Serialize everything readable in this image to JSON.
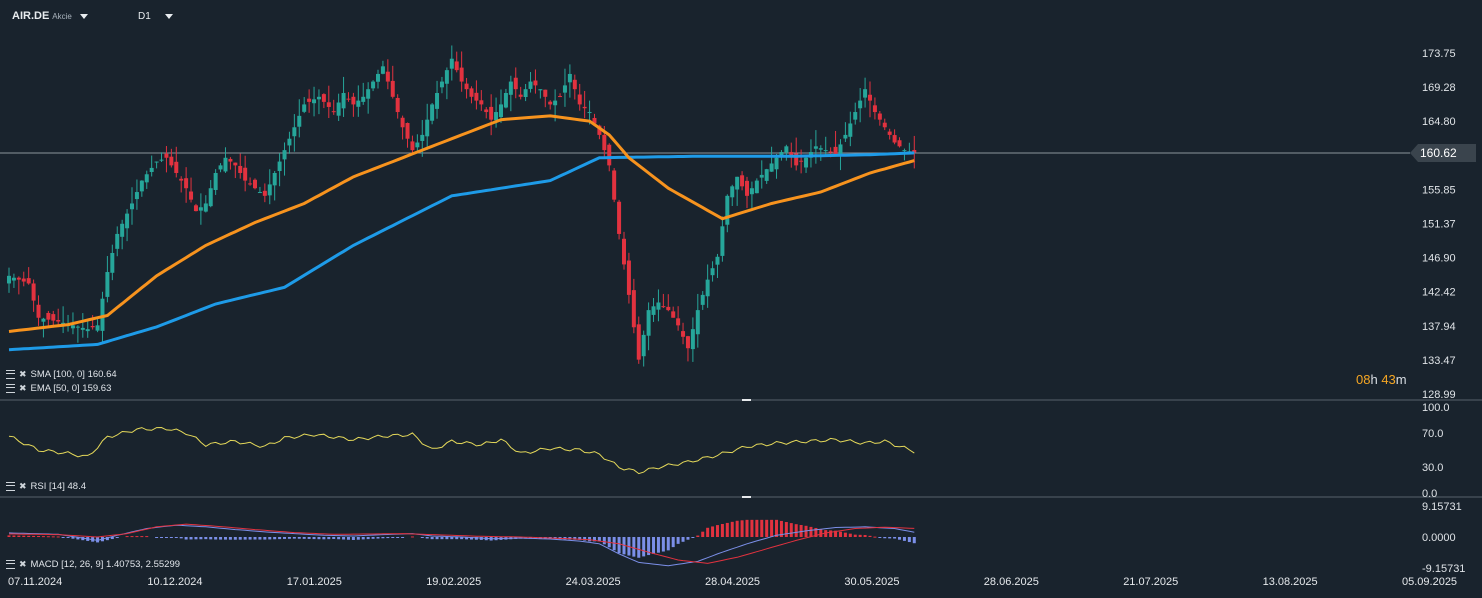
{
  "header": {
    "symbol": "AIR.DE",
    "type": "Akcie",
    "timeframe": "D1"
  },
  "timer": {
    "h": "08",
    "h_unit": "h",
    "m": "43",
    "m_unit": "m"
  },
  "indicators": {
    "sma": "SMA [100, 0] 160.64",
    "ema": "EMA [50, 0] 159.63",
    "rsi": "RSI [14] 48.4",
    "macd": "MACD [12, 26, 9] 1.40753, 2.55299"
  },
  "colors": {
    "bg": "#19232d",
    "up": "#26a69a",
    "down": "#e2323f",
    "sma": "#1e9be8",
    "ema": "#f7931e",
    "rsi": "#e5d95a",
    "macd_signal": "#e2323f",
    "macd_line": "#7b8fe8"
  },
  "chart_data": {
    "type": "candlestick",
    "price_axis": {
      "ticks": [
        "173.75",
        "169.28",
        "164.80",
        "160.62",
        "155.85",
        "151.37",
        "146.90",
        "142.42",
        "137.94",
        "133.47",
        "128.99"
      ],
      "min": 128.99,
      "max": 173.75,
      "current": "160.62"
    },
    "rsi_axis": {
      "ticks": [
        "100.0",
        "70.0",
        "30.0",
        "0.0"
      ]
    },
    "macd_axis": {
      "ticks": [
        "9.15731",
        "0.0000",
        "-9.15731"
      ]
    },
    "x_labels": [
      "07.11.2024",
      "10.12.2024",
      "17.01.2025",
      "19.02.2025",
      "24.03.2025",
      "28.04.2025",
      "30.05.2025",
      "28.06.2025",
      "21.07.2025",
      "13.08.2025",
      "05.09.2025"
    ],
    "anchors": [
      [
        0,
        144.5
      ],
      [
        4,
        143.5
      ],
      [
        6,
        139
      ],
      [
        10,
        138.5
      ],
      [
        13,
        138
      ],
      [
        16,
        137.5
      ],
      [
        18,
        138
      ],
      [
        20,
        145
      ],
      [
        22,
        150
      ],
      [
        25,
        154
      ],
      [
        27,
        157
      ],
      [
        30,
        159.5
      ],
      [
        32,
        160
      ],
      [
        34,
        158
      ],
      [
        36,
        156
      ],
      [
        38,
        153
      ],
      [
        40,
        154
      ],
      [
        42,
        158
      ],
      [
        44,
        160
      ],
      [
        46,
        159
      ],
      [
        48,
        157
      ],
      [
        50,
        156
      ],
      [
        52,
        155
      ],
      [
        54,
        158
      ],
      [
        56,
        161
      ],
      [
        58,
        164
      ],
      [
        60,
        167
      ],
      [
        63,
        168
      ],
      [
        66,
        166
      ],
      [
        68,
        168.5
      ],
      [
        70,
        167
      ],
      [
        72,
        168
      ],
      [
        74,
        170
      ],
      [
        76,
        172
      ],
      [
        78,
        168
      ],
      [
        80,
        164
      ],
      [
        82,
        161
      ],
      [
        84,
        163
      ],
      [
        86,
        167
      ],
      [
        88,
        170
      ],
      [
        90,
        173
      ],
      [
        92,
        170
      ],
      [
        94,
        168
      ],
      [
        96,
        167
      ],
      [
        98,
        165
      ],
      [
        100,
        167
      ],
      [
        102,
        170
      ],
      [
        104,
        168
      ],
      [
        106,
        170
      ],
      [
        108,
        169
      ],
      [
        110,
        167
      ],
      [
        112,
        168
      ],
      [
        114,
        171
      ],
      [
        116,
        167
      ],
      [
        118,
        166
      ],
      [
        120,
        163
      ],
      [
        122,
        159
      ],
      [
        124,
        150
      ],
      [
        126,
        142
      ],
      [
        128,
        133.5
      ],
      [
        130,
        140
      ],
      [
        132,
        141
      ],
      [
        134,
        140
      ],
      [
        136,
        138
      ],
      [
        138,
        135
      ],
      [
        140,
        140
      ],
      [
        142,
        144
      ],
      [
        144,
        147
      ],
      [
        146,
        155
      ],
      [
        148,
        157.5
      ],
      [
        150,
        155
      ],
      [
        152,
        157
      ],
      [
        154,
        158.5
      ],
      [
        156,
        160
      ],
      [
        158,
        161.5
      ],
      [
        160,
        159
      ],
      [
        162,
        160
      ],
      [
        164,
        161.5
      ],
      [
        166,
        161
      ],
      [
        168,
        160.5
      ],
      [
        170,
        163
      ],
      [
        172,
        166
      ],
      [
        174,
        169
      ],
      [
        176,
        166
      ],
      [
        178,
        164
      ],
      [
        180,
        162
      ],
      [
        182,
        161
      ],
      [
        184,
        160.7
      ]
    ],
    "overlays": [
      {
        "name": "SMA [100, 0]",
        "anchors": [
          [
            0,
            134.8
          ],
          [
            18,
            135.5
          ],
          [
            30,
            137.8
          ],
          [
            42,
            140.8
          ],
          [
            56,
            143
          ],
          [
            70,
            148.5
          ],
          [
            90,
            155
          ],
          [
            110,
            157
          ],
          [
            120,
            160
          ],
          [
            140,
            160.2
          ],
          [
            160,
            160.2
          ],
          [
            175,
            160.4
          ],
          [
            184,
            160.64
          ]
        ]
      },
      {
        "name": "EMA [50, 0]",
        "anchors": [
          [
            0,
            137.2
          ],
          [
            12,
            138.1
          ],
          [
            20,
            139.3
          ],
          [
            30,
            144.5
          ],
          [
            40,
            148.5
          ],
          [
            50,
            151.5
          ],
          [
            60,
            154
          ],
          [
            70,
            157.5
          ],
          [
            80,
            160
          ],
          [
            90,
            162.5
          ],
          [
            100,
            165
          ],
          [
            110,
            165.5
          ],
          [
            118,
            164.8
          ],
          [
            122,
            163
          ],
          [
            126,
            160
          ],
          [
            134,
            156
          ],
          [
            145,
            152
          ],
          [
            155,
            154
          ],
          [
            165,
            155.5
          ],
          [
            175,
            158
          ],
          [
            184,
            159.63
          ]
        ]
      }
    ],
    "rsi": {
      "name": "RSI [14]",
      "value": 48.4,
      "anchors": [
        [
          0,
          66
        ],
        [
          6,
          50
        ],
        [
          12,
          46
        ],
        [
          16,
          42
        ],
        [
          20,
          65
        ],
        [
          26,
          74
        ],
        [
          32,
          75
        ],
        [
          36,
          70
        ],
        [
          40,
          56
        ],
        [
          46,
          60
        ],
        [
          52,
          54
        ],
        [
          56,
          64
        ],
        [
          62,
          68
        ],
        [
          70,
          62
        ],
        [
          76,
          66
        ],
        [
          82,
          68
        ],
        [
          86,
          50
        ],
        [
          90,
          60
        ],
        [
          96,
          56
        ],
        [
          100,
          62
        ],
        [
          104,
          46
        ],
        [
          110,
          52
        ],
        [
          116,
          50
        ],
        [
          120,
          45
        ],
        [
          124,
          30
        ],
        [
          128,
          24
        ],
        [
          132,
          30
        ],
        [
          138,
          36
        ],
        [
          144,
          44
        ],
        [
          150,
          54
        ],
        [
          156,
          58
        ],
        [
          162,
          60
        ],
        [
          168,
          62
        ],
        [
          174,
          58
        ],
        [
          178,
          60
        ],
        [
          184,
          48.4
        ]
      ]
    },
    "macd": {
      "name": "MACD [12, 26, 9]",
      "macd_value": 1.40753,
      "signal_value": 2.55299,
      "line_anchors": [
        [
          0,
          1.2
        ],
        [
          10,
          0.8
        ],
        [
          18,
          -1
        ],
        [
          22,
          0.5
        ],
        [
          28,
          2.5
        ],
        [
          34,
          3.5
        ],
        [
          40,
          3
        ],
        [
          46,
          2.2
        ],
        [
          52,
          1.5
        ],
        [
          58,
          1
        ],
        [
          64,
          0.5
        ],
        [
          70,
          0.3
        ],
        [
          76,
          0.7
        ],
        [
          82,
          1
        ],
        [
          86,
          0.3
        ],
        [
          92,
          0
        ],
        [
          98,
          -0.5
        ],
        [
          104,
          -0.3
        ],
        [
          110,
          -0.6
        ],
        [
          116,
          -1.2
        ],
        [
          120,
          -2
        ],
        [
          124,
          -5
        ],
        [
          128,
          -7.5
        ],
        [
          134,
          -8.5
        ],
        [
          140,
          -7.2
        ],
        [
          144,
          -5
        ],
        [
          150,
          -2
        ],
        [
          156,
          0.5
        ],
        [
          162,
          1.8
        ],
        [
          168,
          2.8
        ],
        [
          174,
          3
        ],
        [
          180,
          2.5
        ],
        [
          184,
          1.40753
        ]
      ],
      "signal_anchors": [
        [
          0,
          0.9
        ],
        [
          10,
          0.7
        ],
        [
          18,
          0
        ],
        [
          24,
          1
        ],
        [
          30,
          3
        ],
        [
          36,
          3.8
        ],
        [
          42,
          3.2
        ],
        [
          50,
          2.2
        ],
        [
          58,
          1.3
        ],
        [
          66,
          0.8
        ],
        [
          74,
          0.9
        ],
        [
          80,
          1
        ],
        [
          88,
          0.6
        ],
        [
          96,
          0.2
        ],
        [
          104,
          0
        ],
        [
          112,
          -0.4
        ],
        [
          118,
          -0.8
        ],
        [
          124,
          -2
        ],
        [
          130,
          -4.5
        ],
        [
          136,
          -6.8
        ],
        [
          142,
          -7.8
        ],
        [
          148,
          -6
        ],
        [
          154,
          -3.5
        ],
        [
          160,
          -1
        ],
        [
          166,
          1.2
        ],
        [
          172,
          2.5
        ],
        [
          178,
          2.9
        ],
        [
          184,
          2.55299
        ]
      ]
    }
  }
}
